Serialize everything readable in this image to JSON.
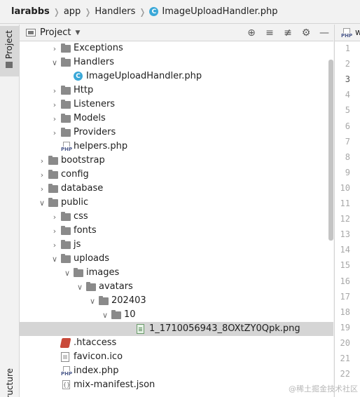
{
  "breadcrumb": {
    "project": "larabbs",
    "items": [
      "app",
      "Handlers",
      "ImageUploadHandler.php"
    ]
  },
  "tool_strip": {
    "project_label": "Project",
    "structure_label": "Structure"
  },
  "panel": {
    "title": "Project"
  },
  "tree": [
    {
      "label": "Exceptions",
      "kind": "folder",
      "depth": 2,
      "arrow": "collapsed"
    },
    {
      "label": "Handlers",
      "kind": "folder",
      "depth": 2,
      "arrow": "expanded"
    },
    {
      "label": "ImageUploadHandler.php",
      "kind": "class",
      "depth": 3,
      "arrow": "none"
    },
    {
      "label": "Http",
      "kind": "folder",
      "depth": 2,
      "arrow": "collapsed"
    },
    {
      "label": "Listeners",
      "kind": "folder",
      "depth": 2,
      "arrow": "collapsed"
    },
    {
      "label": "Models",
      "kind": "folder",
      "depth": 2,
      "arrow": "collapsed"
    },
    {
      "label": "Providers",
      "kind": "folder",
      "depth": 2,
      "arrow": "collapsed"
    },
    {
      "label": "helpers.php",
      "kind": "php",
      "depth": 2,
      "arrow": "none"
    },
    {
      "label": "bootstrap",
      "kind": "folder",
      "depth": 1,
      "arrow": "collapsed"
    },
    {
      "label": "config",
      "kind": "folder",
      "depth": 1,
      "arrow": "collapsed"
    },
    {
      "label": "database",
      "kind": "folder",
      "depth": 1,
      "arrow": "collapsed"
    },
    {
      "label": "public",
      "kind": "folder",
      "depth": 1,
      "arrow": "expanded"
    },
    {
      "label": "css",
      "kind": "folder",
      "depth": 2,
      "arrow": "collapsed"
    },
    {
      "label": "fonts",
      "kind": "folder",
      "depth": 2,
      "arrow": "collapsed"
    },
    {
      "label": "js",
      "kind": "folder",
      "depth": 2,
      "arrow": "collapsed"
    },
    {
      "label": "uploads",
      "kind": "folder",
      "depth": 2,
      "arrow": "expanded"
    },
    {
      "label": "images",
      "kind": "folder",
      "depth": 3,
      "arrow": "expanded"
    },
    {
      "label": "avatars",
      "kind": "folder",
      "depth": 4,
      "arrow": "expanded"
    },
    {
      "label": "202403",
      "kind": "folder",
      "depth": 5,
      "arrow": "expanded"
    },
    {
      "label": "10",
      "kind": "folder",
      "depth": 6,
      "arrow": "expanded"
    },
    {
      "label": "1_1710056943_8OXtZY0Qpk.png",
      "kind": "png",
      "depth": 8,
      "arrow": "none",
      "selected": true
    },
    {
      "label": ".htaccess",
      "kind": "htaccess",
      "depth": 2,
      "arrow": "none"
    },
    {
      "label": "favicon.ico",
      "kind": "ico",
      "depth": 2,
      "arrow": "none"
    },
    {
      "label": "index.php",
      "kind": "php",
      "depth": 2,
      "arrow": "none"
    },
    {
      "label": "mix-manifest.json",
      "kind": "json",
      "depth": 2,
      "arrow": "none"
    }
  ],
  "editor": {
    "tab_fragment": "w",
    "current_line": 3,
    "line_numbers": [
      "1",
      "2",
      "3",
      "4",
      "5",
      "6",
      "7",
      "8",
      "9",
      "10",
      "11",
      "12",
      "13",
      "14",
      "15",
      "16",
      "17",
      "18",
      "19",
      "20",
      "21",
      "22"
    ]
  },
  "watermark": "@稀土掘金技术社区"
}
